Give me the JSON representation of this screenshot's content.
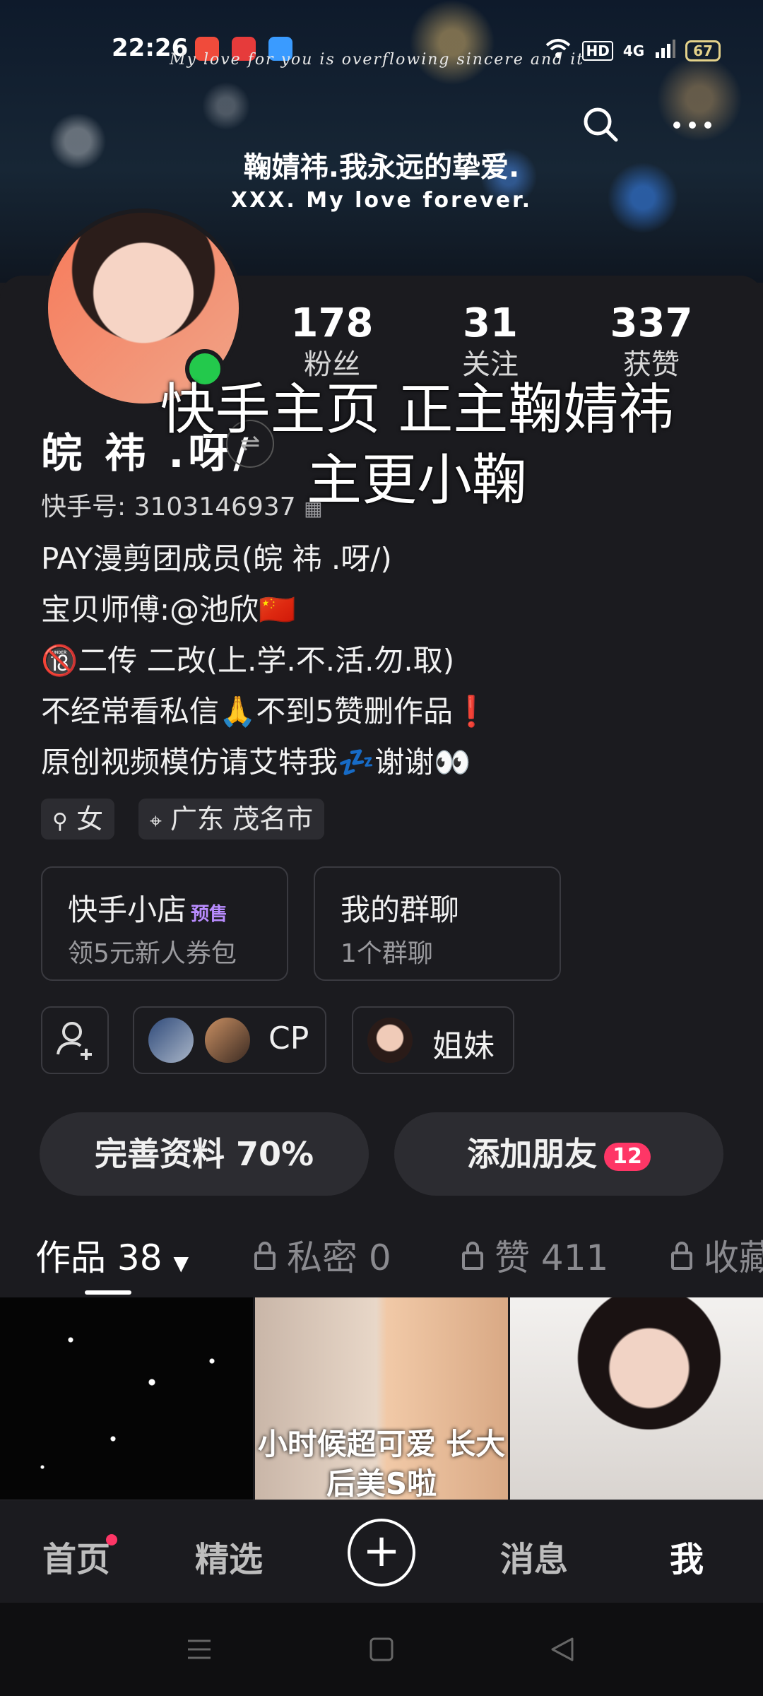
{
  "status_bar": {
    "time": "22:26",
    "network": "4G",
    "hd": "HD",
    "battery": "67"
  },
  "cover": {
    "script_text": "My love for you is overflowing sincere and it",
    "title_cn": "鞠婧祎.我永远的挚爱.",
    "title_en": "XXX. My love forever."
  },
  "stats": [
    {
      "value": "178",
      "label": "粉丝"
    },
    {
      "value": "31",
      "label": "关注"
    },
    {
      "value": "337",
      "label": "获赞"
    }
  ],
  "overlay_title": "快手主页 正主鞠婧祎主更小鞠",
  "profile": {
    "nickname": "皖 祎 .呀/",
    "account_id": "快手号: 3103146937",
    "bio": [
      "PAY漫剪团成员(皖 祎 .呀/)",
      "宝贝师傅:@池欣🇨🇳",
      "🔞二传 二改(上.学.不.活.勿.取)",
      "不经常看私信🙏不到5赞删作品❗",
      "原创视频模仿请艾特我💤谢谢👀"
    ],
    "gender_tag": "女",
    "location_tag": "广东 茂名市"
  },
  "cards": {
    "shop": {
      "title": "快手小店",
      "badge": "预售",
      "subtitle": "领5元新人券包"
    },
    "group": {
      "title": "我的群聊",
      "subtitle": "1个群聊"
    }
  },
  "relations": {
    "cp_label": "CP",
    "sisters_label": "姐妹"
  },
  "actions": {
    "complete_profile": "完善资料 70%",
    "add_friends": "添加朋友",
    "add_friends_badge": "12"
  },
  "tabs": [
    {
      "label": "作品 38"
    },
    {
      "label": "私密 0"
    },
    {
      "label": "赞 411"
    },
    {
      "label": "收藏"
    }
  ],
  "grid": {
    "item2_caption": "小时候超可爱 长大后美S啦"
  },
  "bottom_nav": {
    "home": "首页",
    "featured": "精选",
    "messages": "消息",
    "me": "我"
  }
}
